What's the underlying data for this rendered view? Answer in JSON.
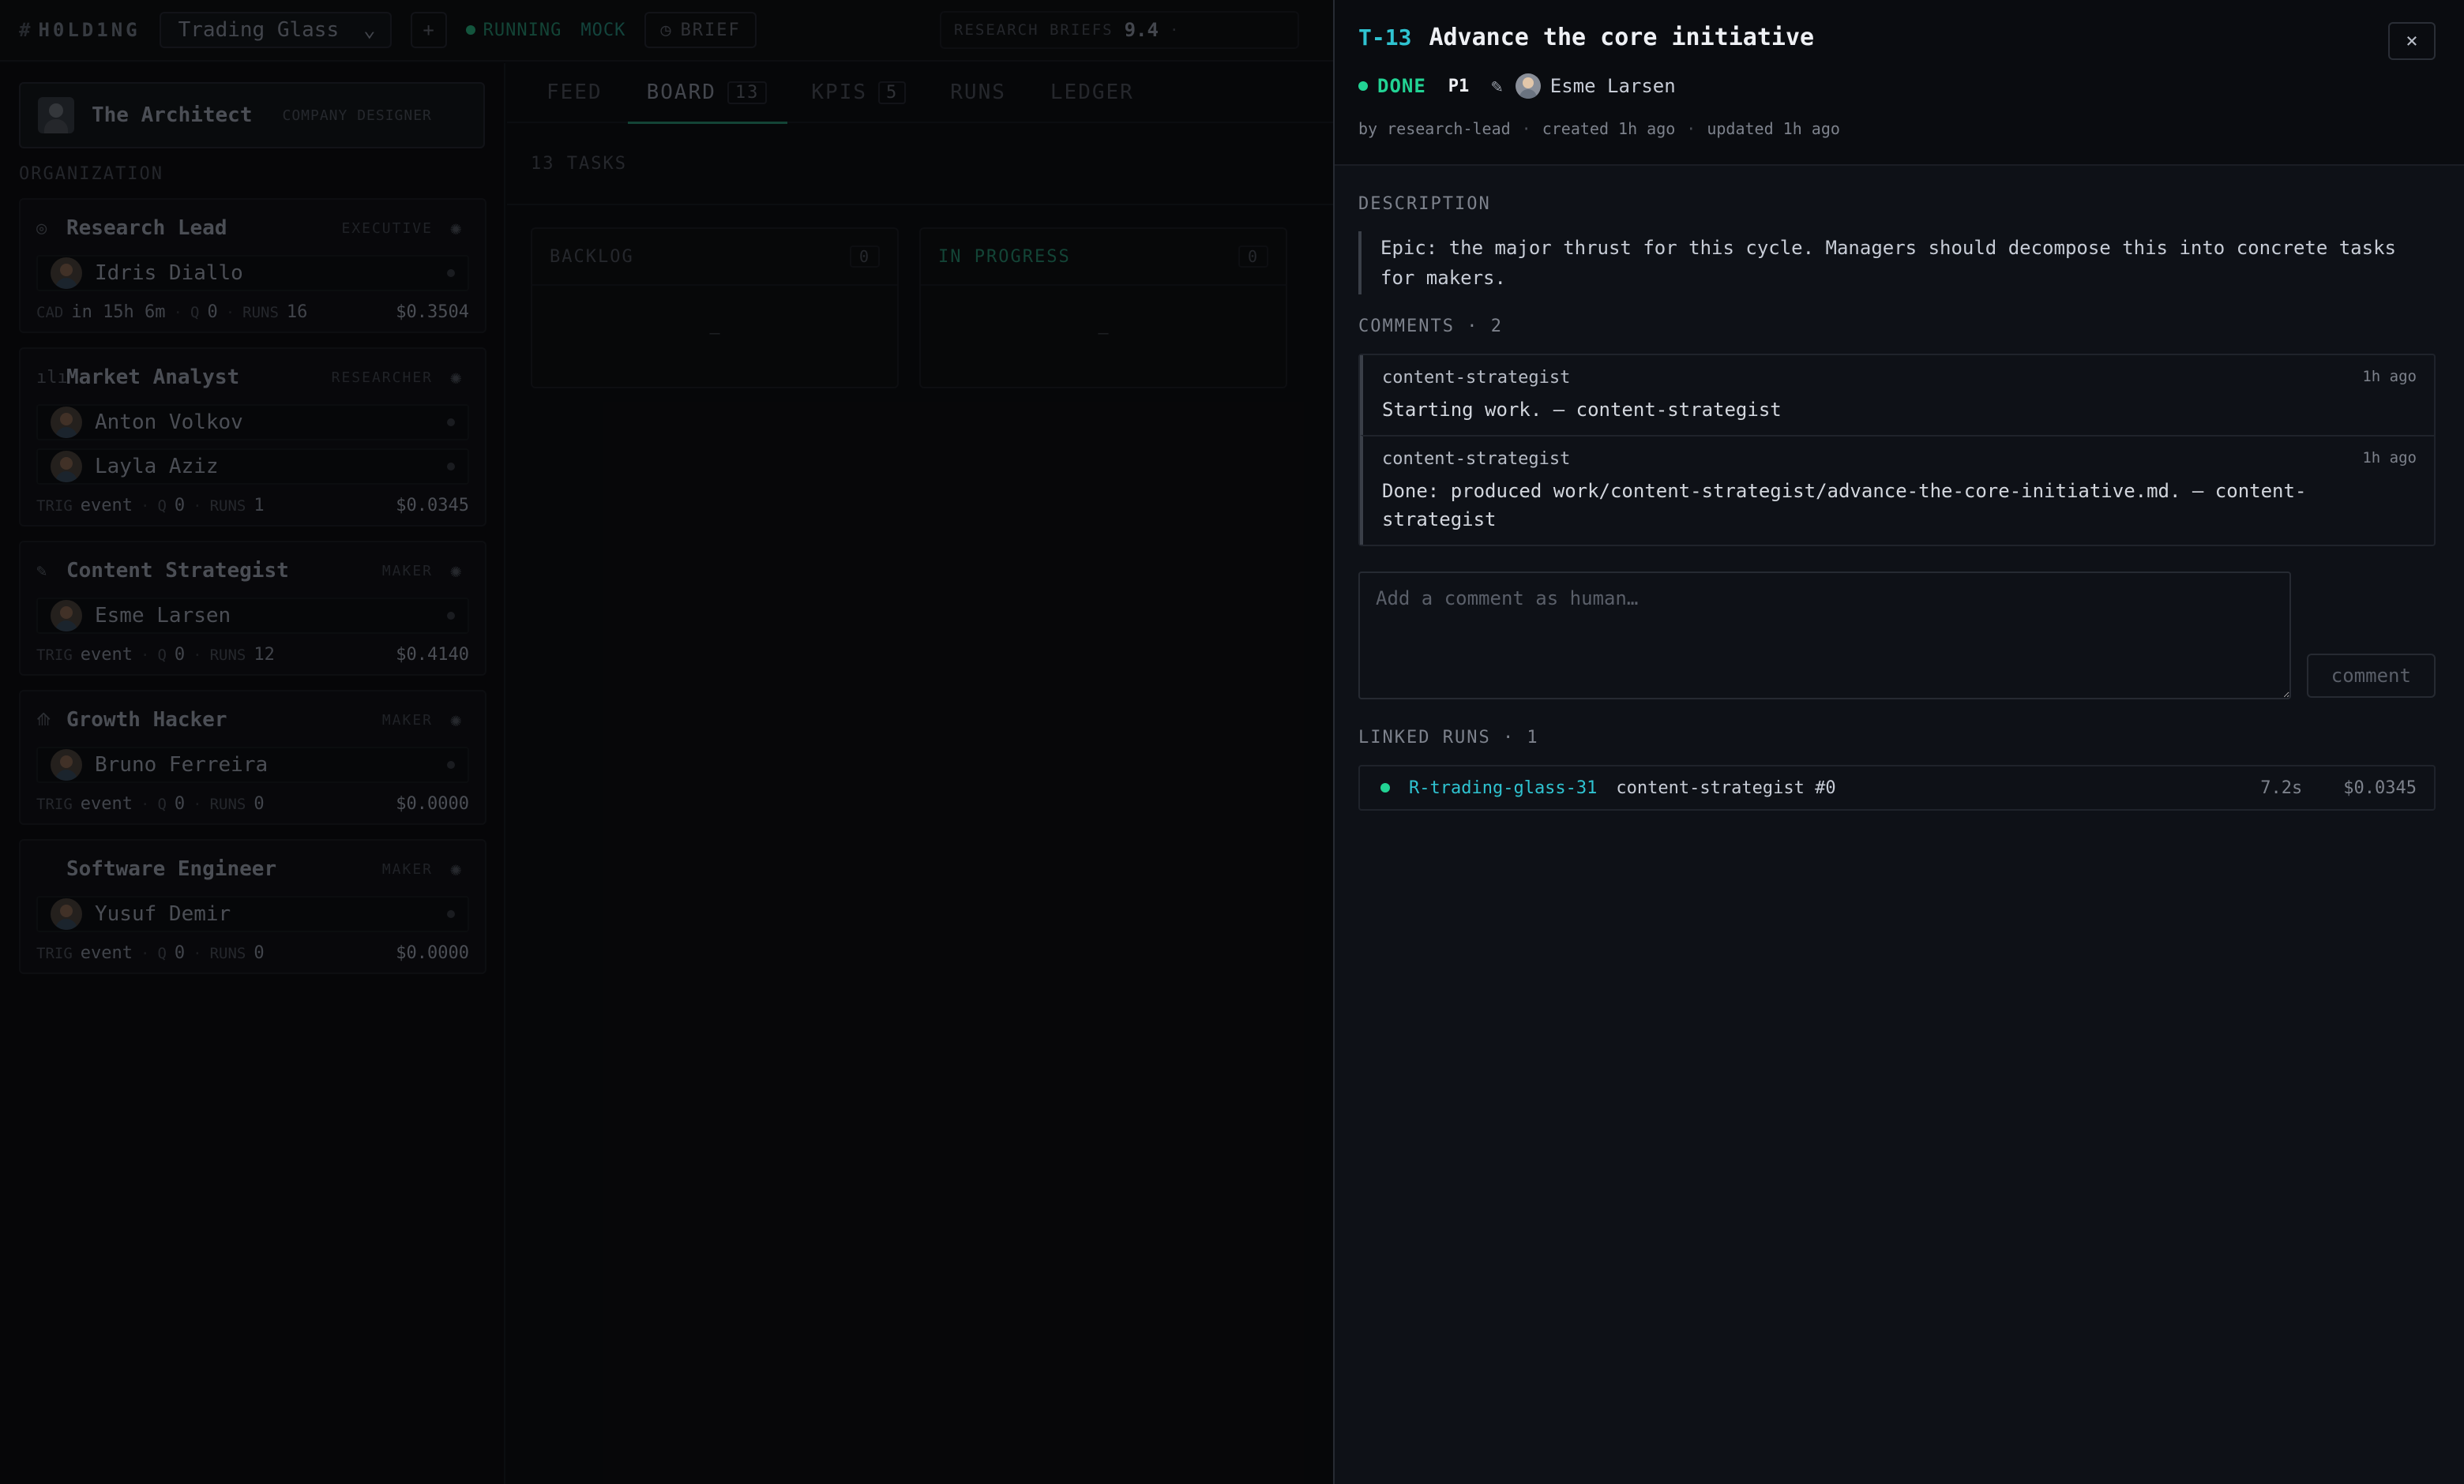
{
  "app": {
    "logo": "H0LD1NG",
    "company": "Trading Glass",
    "status": "RUNNING",
    "mode": "MOCK",
    "brief_label": "BRIEF",
    "research_briefs_label": "RESEARCH BRIEFS",
    "research_briefs_value": "9.4"
  },
  "sidebar": {
    "architect": {
      "name": "The Architect",
      "role": "COMPANY DESIGNER"
    },
    "section_label": "ORGANIZATION",
    "roles": [
      {
        "icon": "compass-icon",
        "name": "Research Lead",
        "tier": "EXECUTIVE",
        "members": [
          "Idris Diallo"
        ],
        "foot_key": "CAD",
        "foot_val": "in 15h 6m",
        "q": "0",
        "runs": "16",
        "cost": "$0.3504"
      },
      {
        "icon": "bar-chart-icon",
        "name": "Market Analyst",
        "tier": "RESEARCHER",
        "members": [
          "Anton Volkov",
          "Layla Aziz"
        ],
        "foot_key": "TRIG",
        "foot_val": "event",
        "q": "0",
        "runs": "1",
        "cost": "$0.0345"
      },
      {
        "icon": "feather-icon",
        "name": "Content Strategist",
        "tier": "MAKER",
        "members": [
          "Esme Larsen"
        ],
        "foot_key": "TRIG",
        "foot_val": "event",
        "q": "0",
        "runs": "12",
        "cost": "$0.4140"
      },
      {
        "icon": "rocket-icon",
        "name": "Growth Hacker",
        "tier": "MAKER",
        "members": [
          "Bruno Ferreira"
        ],
        "foot_key": "TRIG",
        "foot_val": "event",
        "q": "0",
        "runs": "0",
        "cost": "$0.0000"
      },
      {
        "icon": "code-icon",
        "name": "Software Engineer",
        "tier": "MAKER",
        "members": [
          "Yusuf Demir"
        ],
        "foot_key": "TRIG",
        "foot_val": "event",
        "q": "0",
        "runs": "0",
        "cost": "$0.0000"
      }
    ],
    "q_label": "Q",
    "runs_label": "RUNS"
  },
  "main": {
    "tabs": [
      {
        "label": "FEED",
        "count": ""
      },
      {
        "label": "BOARD",
        "count": "13"
      },
      {
        "label": "KPIS",
        "count": "5"
      },
      {
        "label": "RUNS",
        "count": ""
      },
      {
        "label": "LEDGER",
        "count": ""
      }
    ],
    "tasks_label": "13 TASKS",
    "columns": [
      {
        "name": "BACKLOG",
        "count": "0",
        "empty": "—",
        "color": "#3c4048"
      },
      {
        "name": "IN PROGRESS",
        "count": "0",
        "empty": "—",
        "color": "#1f6e57"
      }
    ]
  },
  "task": {
    "id": "T-13",
    "title": "Advance the core initiative",
    "status": "DONE",
    "priority": "P1",
    "assignee": "Esme Larsen",
    "by": "by research-lead",
    "created": "created 1h ago",
    "updated": "updated 1h ago",
    "description_label": "DESCRIPTION",
    "description": "Epic: the major thrust for this cycle. Managers should decompose this into concrete tasks for makers.",
    "comments_label": "COMMENTS · 2",
    "comments": [
      {
        "author": "content-strategist",
        "time": "1h ago",
        "text": "Starting work. — content-strategist"
      },
      {
        "author": "content-strategist",
        "time": "1h ago",
        "text": "Done: produced work/content-strategist/advance-the-core-initiative.md. — content-strategist"
      }
    ],
    "comment_placeholder": "Add a comment as human…",
    "comment_button": "comment",
    "linked_runs_label": "LINKED RUNS · 1",
    "runs": [
      {
        "id": "R-trading-glass-31",
        "agent": "content-strategist #0",
        "duration": "7.2s",
        "cost": "$0.0345"
      }
    ],
    "close_label": "×"
  },
  "colors": {
    "accent_cyan": "#2fc3d1",
    "done_green": "#22d394",
    "running_green": "#1f6e57"
  }
}
